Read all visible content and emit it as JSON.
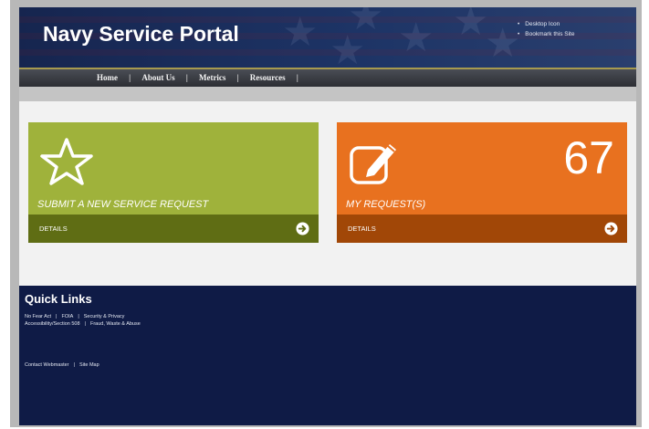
{
  "header": {
    "site_title": "Navy Service Portal",
    "utility_links": [
      "Desktop Icon",
      "Bookmark this Site"
    ]
  },
  "nav": {
    "items": [
      "Home",
      "About Us",
      "Metrics",
      "Resources"
    ],
    "separator": "|"
  },
  "tiles": [
    {
      "caption": "SUBMIT A NEW SERVICE REQUEST",
      "footer_label": "DETAILS",
      "icon": "star-icon",
      "color": "#9fb23b",
      "footer_color": "#5f6d14"
    },
    {
      "caption": "MY REQUEST(S)",
      "count": "67",
      "footer_label": "DETAILS",
      "icon": "edit-icon",
      "color": "#e8711f",
      "footer_color": "#a14707"
    }
  ],
  "footer": {
    "title": "Quick Links",
    "row1": [
      "No Fear Act",
      "FOIA",
      "Security & Privacy"
    ],
    "row2": [
      "Accessibility/Section 508",
      "Fraud, Waste & Abuse"
    ],
    "row3": [
      "Contact Webmaster",
      "Site Map"
    ],
    "separator": "|"
  },
  "colors": {
    "header_bg": "#1d3466",
    "footer_bg": "#0f1b46",
    "nav_accent": "#a79a4f"
  }
}
